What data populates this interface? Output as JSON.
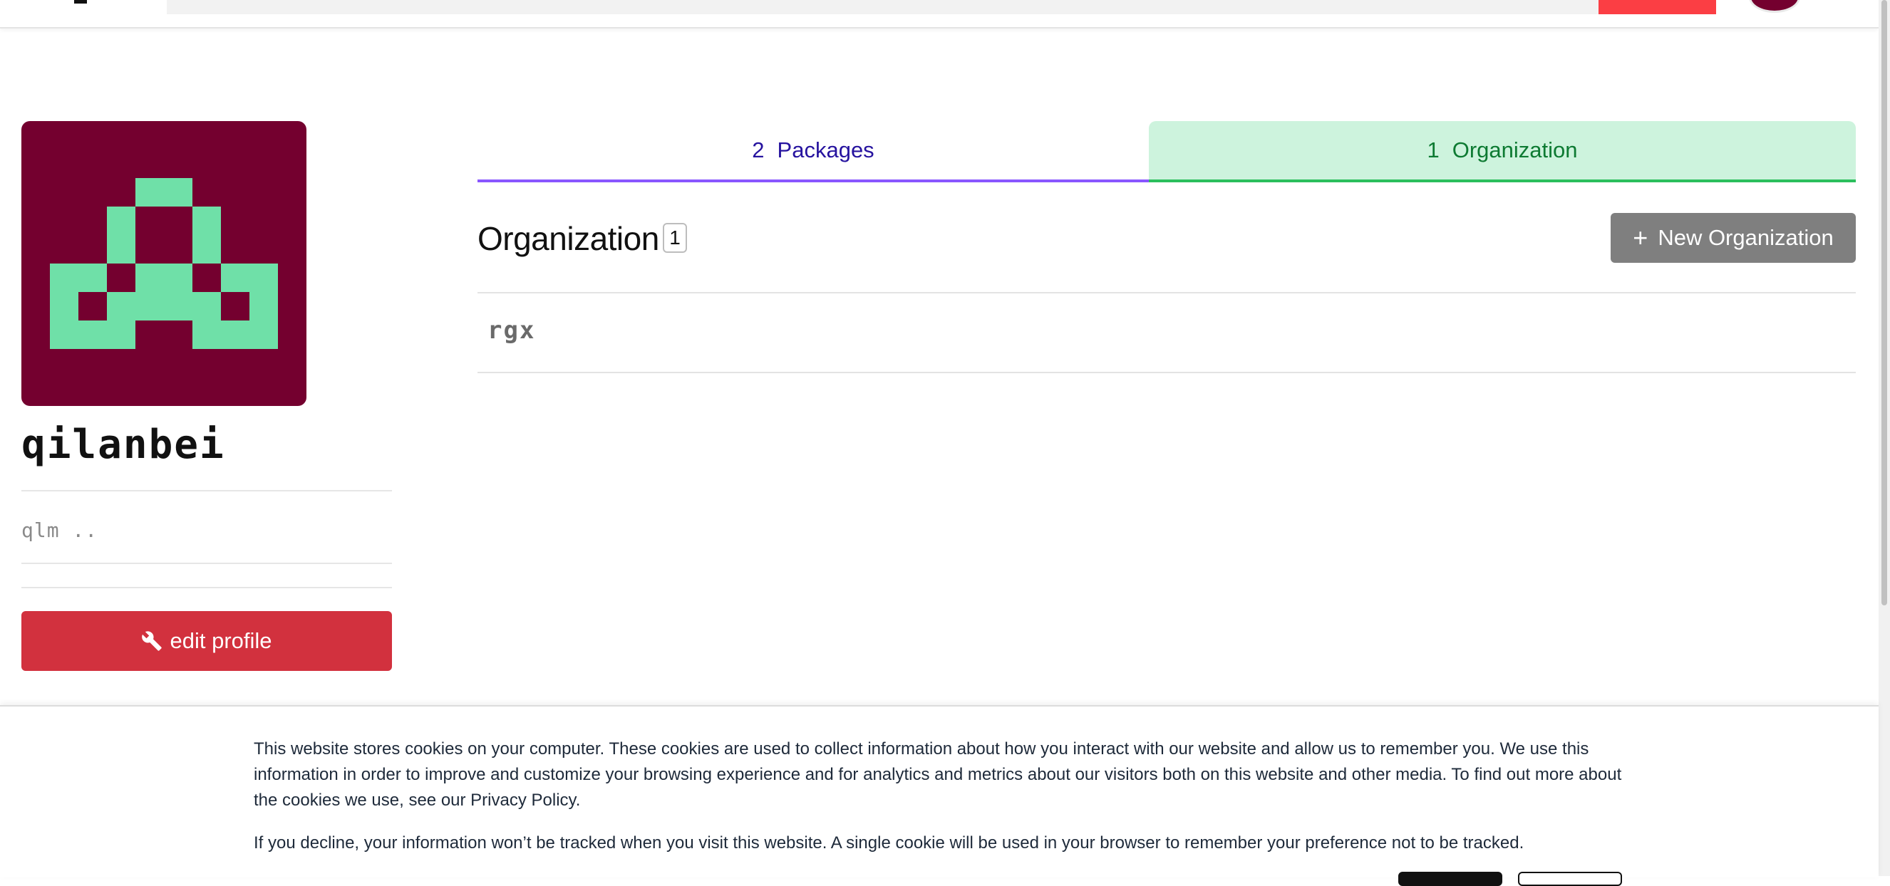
{
  "profile": {
    "username": "qilanbei",
    "fullname": "qlm ..",
    "edit_label": "edit profile",
    "avatar_colors": {
      "background": "#74002f",
      "foreground": "#6fe0a8"
    }
  },
  "tabs": [
    {
      "count": "2",
      "label": "Packages"
    },
    {
      "count": "1",
      "label": "Organization"
    }
  ],
  "section": {
    "title": "Organization",
    "count": "1",
    "new_button_label": "New Organization"
  },
  "organizations": [
    {
      "name": "rgx"
    }
  ],
  "cookie_banner": {
    "paragraph1": "This website stores cookies on your computer. These cookies are used to collect information about how you interact with our website and allow us to remember you. We use this information in order to improve and customize your browsing experience and for analytics and metrics about our visitors both on this website and other media. To find out more about the cookies we use, see our Privacy Policy.",
    "paragraph2": "If you decline, your information won’t be tracked when you visit this website. A single cookie will be used in your browser to remember your preference not to be tracked."
  },
  "colors": {
    "accent_red": "#d2313e",
    "search_button": "#fb3e44",
    "tab_packages": "#26139f",
    "tab_org_bg": "#cdf3dd",
    "tab_org_text": "#0d7a32"
  }
}
